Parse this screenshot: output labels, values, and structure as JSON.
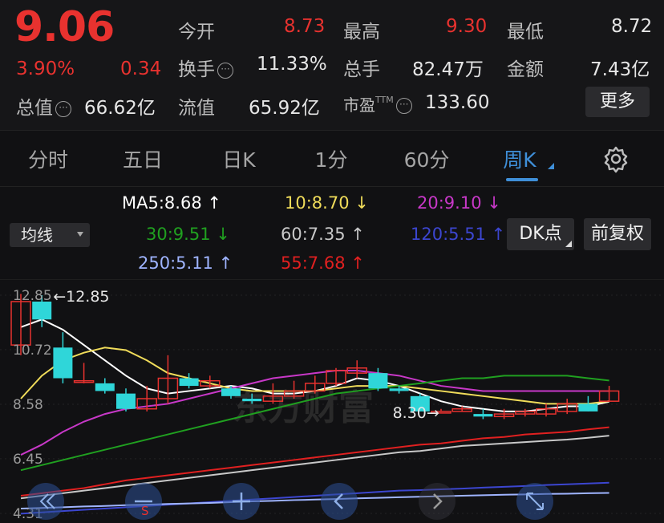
{
  "quote": {
    "price": "9.06",
    "change_pct": "3.90%",
    "change_abs": "0.34",
    "open_label": "今开",
    "open_value": "8.73",
    "high_label": "最高",
    "high_value": "9.30",
    "low_label": "最低",
    "low_value": "8.72",
    "turnover_label": "换手",
    "turnover_value": "11.33%",
    "volume_label": "总手",
    "volume_value": "82.47万",
    "amount_label": "金额",
    "amount_value": "7.43亿",
    "mktcap_label": "总值",
    "mktcap_value": "66.62亿",
    "float_label": "流值",
    "float_value": "65.92亿",
    "pe_label": "市盈",
    "pe_sup": "TTM",
    "pe_value": "133.60",
    "more_label": "更多"
  },
  "tabs": [
    {
      "label": "分时"
    },
    {
      "label": "五日"
    },
    {
      "label": "日K"
    },
    {
      "label": "1分"
    },
    {
      "label": "60分"
    },
    {
      "label": "周K"
    }
  ],
  "ma": {
    "ma5": "MA5:8.68 ↑",
    "ma10": "10:8.70 ↓",
    "ma20": "20:9.10 ↓",
    "ma30": "30:9.51 ↓",
    "ma60": "60:7.35 ↑",
    "ma120": "120:5.51 ↑",
    "ma250": "250:5.11 ↑",
    "ma55": "55:7.68 ↑"
  },
  "controls": {
    "avg_select": "均线",
    "dk_label": "DK点",
    "adjust_label": "前复权"
  },
  "colors": {
    "up": "#e8322f",
    "down": "#2fd6d9",
    "ma5": "#ffffff",
    "ma10": "#f0dc5a",
    "ma20": "#c838c8",
    "ma30": "#20a020",
    "ma60": "#c8c8c8",
    "ma120": "#3c46d0",
    "ma250": "#9fb4ff",
    "ma55": "#e02020",
    "accent": "#3f8fd8"
  },
  "chart_data": {
    "type": "candlestick",
    "y_ticks": [
      "12.85",
      "10.72",
      "8.58",
      "6.45",
      "4.31"
    ],
    "ylim": [
      4.31,
      12.85
    ],
    "annotations": [
      {
        "label": "←12.85",
        "value": 12.85
      },
      {
        "label": "8.30→",
        "value": 8.3
      }
    ],
    "candles": [
      {
        "o": 10.9,
        "c": 12.6,
        "h": 12.9,
        "l": 10.5
      },
      {
        "o": 12.6,
        "c": 11.9,
        "h": 12.85,
        "l": 11.6
      },
      {
        "o": 10.8,
        "c": 9.6,
        "h": 11.4,
        "l": 9.4
      },
      {
        "o": 9.5,
        "c": 9.5,
        "h": 10.2,
        "l": 9.4
      },
      {
        "o": 9.4,
        "c": 9.1,
        "h": 9.6,
        "l": 9.0
      },
      {
        "o": 9.0,
        "c": 8.4,
        "h": 9.2,
        "l": 8.3
      },
      {
        "o": 8.4,
        "c": 8.8,
        "h": 9.3,
        "l": 8.3
      },
      {
        "o": 8.8,
        "c": 9.6,
        "h": 10.5,
        "l": 8.6
      },
      {
        "o": 9.6,
        "c": 9.3,
        "h": 9.8,
        "l": 9.2
      },
      {
        "o": 9.3,
        "c": 9.5,
        "h": 9.7,
        "l": 9.2
      },
      {
        "o": 9.2,
        "c": 8.9,
        "h": 9.3,
        "l": 8.8
      },
      {
        "o": 8.8,
        "c": 8.7,
        "h": 9.0,
        "l": 8.6
      },
      {
        "o": 8.7,
        "c": 8.9,
        "h": 9.4,
        "l": 8.6
      },
      {
        "o": 8.9,
        "c": 9.1,
        "h": 9.5,
        "l": 8.8
      },
      {
        "o": 9.1,
        "c": 9.4,
        "h": 9.7,
        "l": 9.0
      },
      {
        "o": 9.4,
        "c": 9.9,
        "h": 10.0,
        "l": 9.3
      },
      {
        "o": 9.8,
        "c": 10.0,
        "h": 10.3,
        "l": 9.6
      },
      {
        "o": 9.8,
        "c": 9.2,
        "h": 10.0,
        "l": 9.1
      },
      {
        "o": 9.2,
        "c": 9.1,
        "h": 9.3,
        "l": 9.0
      },
      {
        "o": 8.9,
        "c": 8.3,
        "h": 9.0,
        "l": 8.3
      },
      {
        "o": 8.3,
        "c": 8.3,
        "h": 8.4,
        "l": 8.3
      },
      {
        "o": 8.3,
        "c": 8.4,
        "h": 8.5,
        "l": 8.3
      },
      {
        "o": 8.2,
        "c": 8.1,
        "h": 8.4,
        "l": 8.0
      },
      {
        "o": 8.1,
        "c": 8.2,
        "h": 8.4,
        "l": 8.0
      },
      {
        "o": 8.2,
        "c": 8.3,
        "h": 8.4,
        "l": 8.1
      },
      {
        "o": 8.2,
        "c": 8.4,
        "h": 8.6,
        "l": 8.1
      },
      {
        "o": 8.3,
        "c": 8.6,
        "h": 8.8,
        "l": 8.2
      },
      {
        "o": 8.6,
        "c": 8.3,
        "h": 8.9,
        "l": 8.3
      },
      {
        "o": 8.7,
        "c": 9.1,
        "h": 9.3,
        "l": 8.7
      }
    ],
    "series": [
      {
        "key": "ma5",
        "values": [
          11.6,
          11.9,
          11.5,
          10.9,
          10.3,
          9.7,
          9.2,
          9.0,
          9.1,
          9.2,
          9.3,
          9.2,
          9.0,
          9.0,
          9.1,
          9.3,
          9.6,
          9.5,
          9.3,
          9.0,
          8.7,
          8.5,
          8.4,
          8.3,
          8.3,
          8.4,
          8.5,
          8.5,
          8.68
        ]
      },
      {
        "key": "ma10",
        "values": [
          8.8,
          9.7,
          10.3,
          10.6,
          10.8,
          10.7,
          10.3,
          9.8,
          9.6,
          9.4,
          9.2,
          9.1,
          9.1,
          9.1,
          9.1,
          9.2,
          9.3,
          9.3,
          9.3,
          9.2,
          9.1,
          9.0,
          8.9,
          8.8,
          8.7,
          8.6,
          8.6,
          8.6,
          8.7
        ]
      },
      {
        "key": "ma20",
        "values": [
          6.6,
          7.0,
          7.5,
          7.9,
          8.2,
          8.4,
          8.5,
          8.6,
          8.8,
          9.0,
          9.2,
          9.4,
          9.6,
          9.7,
          9.8,
          9.9,
          9.9,
          9.8,
          9.7,
          9.5,
          9.3,
          9.2,
          9.1,
          9.1,
          9.1,
          9.1,
          9.1,
          9.1,
          9.1
        ]
      },
      {
        "key": "ma30",
        "values": [
          6.0,
          6.2,
          6.4,
          6.6,
          6.8,
          7.0,
          7.2,
          7.4,
          7.6,
          7.8,
          8.0,
          8.2,
          8.4,
          8.6,
          8.8,
          9.0,
          9.1,
          9.2,
          9.3,
          9.4,
          9.5,
          9.6,
          9.6,
          9.7,
          9.7,
          9.7,
          9.7,
          9.6,
          9.51
        ]
      },
      {
        "key": "ma60",
        "values": [
          4.9,
          5.0,
          5.1,
          5.2,
          5.3,
          5.4,
          5.5,
          5.6,
          5.7,
          5.8,
          5.9,
          6.0,
          6.1,
          6.2,
          6.3,
          6.4,
          6.5,
          6.6,
          6.7,
          6.75,
          6.85,
          6.95,
          7.0,
          7.05,
          7.1,
          7.15,
          7.2,
          7.27,
          7.35
        ]
      },
      {
        "key": "ma55",
        "values": [
          5.0,
          5.1,
          5.2,
          5.3,
          5.45,
          5.6,
          5.7,
          5.8,
          5.9,
          6.0,
          6.1,
          6.2,
          6.3,
          6.4,
          6.5,
          6.6,
          6.7,
          6.8,
          6.9,
          7.0,
          7.05,
          7.15,
          7.25,
          7.3,
          7.4,
          7.45,
          7.5,
          7.6,
          7.68
        ]
      },
      {
        "key": "ma120",
        "values": [
          4.3,
          4.35,
          4.4,
          4.45,
          4.5,
          4.55,
          4.6,
          4.65,
          4.7,
          4.75,
          4.8,
          4.85,
          4.9,
          4.95,
          5.0,
          5.05,
          5.1,
          5.15,
          5.2,
          5.22,
          5.25,
          5.28,
          5.32,
          5.35,
          5.38,
          5.42,
          5.45,
          5.48,
          5.51
        ]
      },
      {
        "key": "ma250",
        "values": [
          4.5,
          4.52,
          4.55,
          4.58,
          4.6,
          4.63,
          4.65,
          4.68,
          4.7,
          4.72,
          4.75,
          4.78,
          4.8,
          4.83,
          4.85,
          4.87,
          4.9,
          4.92,
          4.94,
          4.96,
          4.98,
          5.0,
          5.02,
          5.04,
          5.05,
          5.07,
          5.08,
          5.1,
          5.11
        ]
      }
    ]
  },
  "nav": {
    "icons": [
      "double-left-icon",
      "zoom-out-icon",
      "zoom-in-icon",
      "left-icon",
      "right-icon",
      "fullscreen-icon"
    ],
    "s_mark": "S"
  }
}
